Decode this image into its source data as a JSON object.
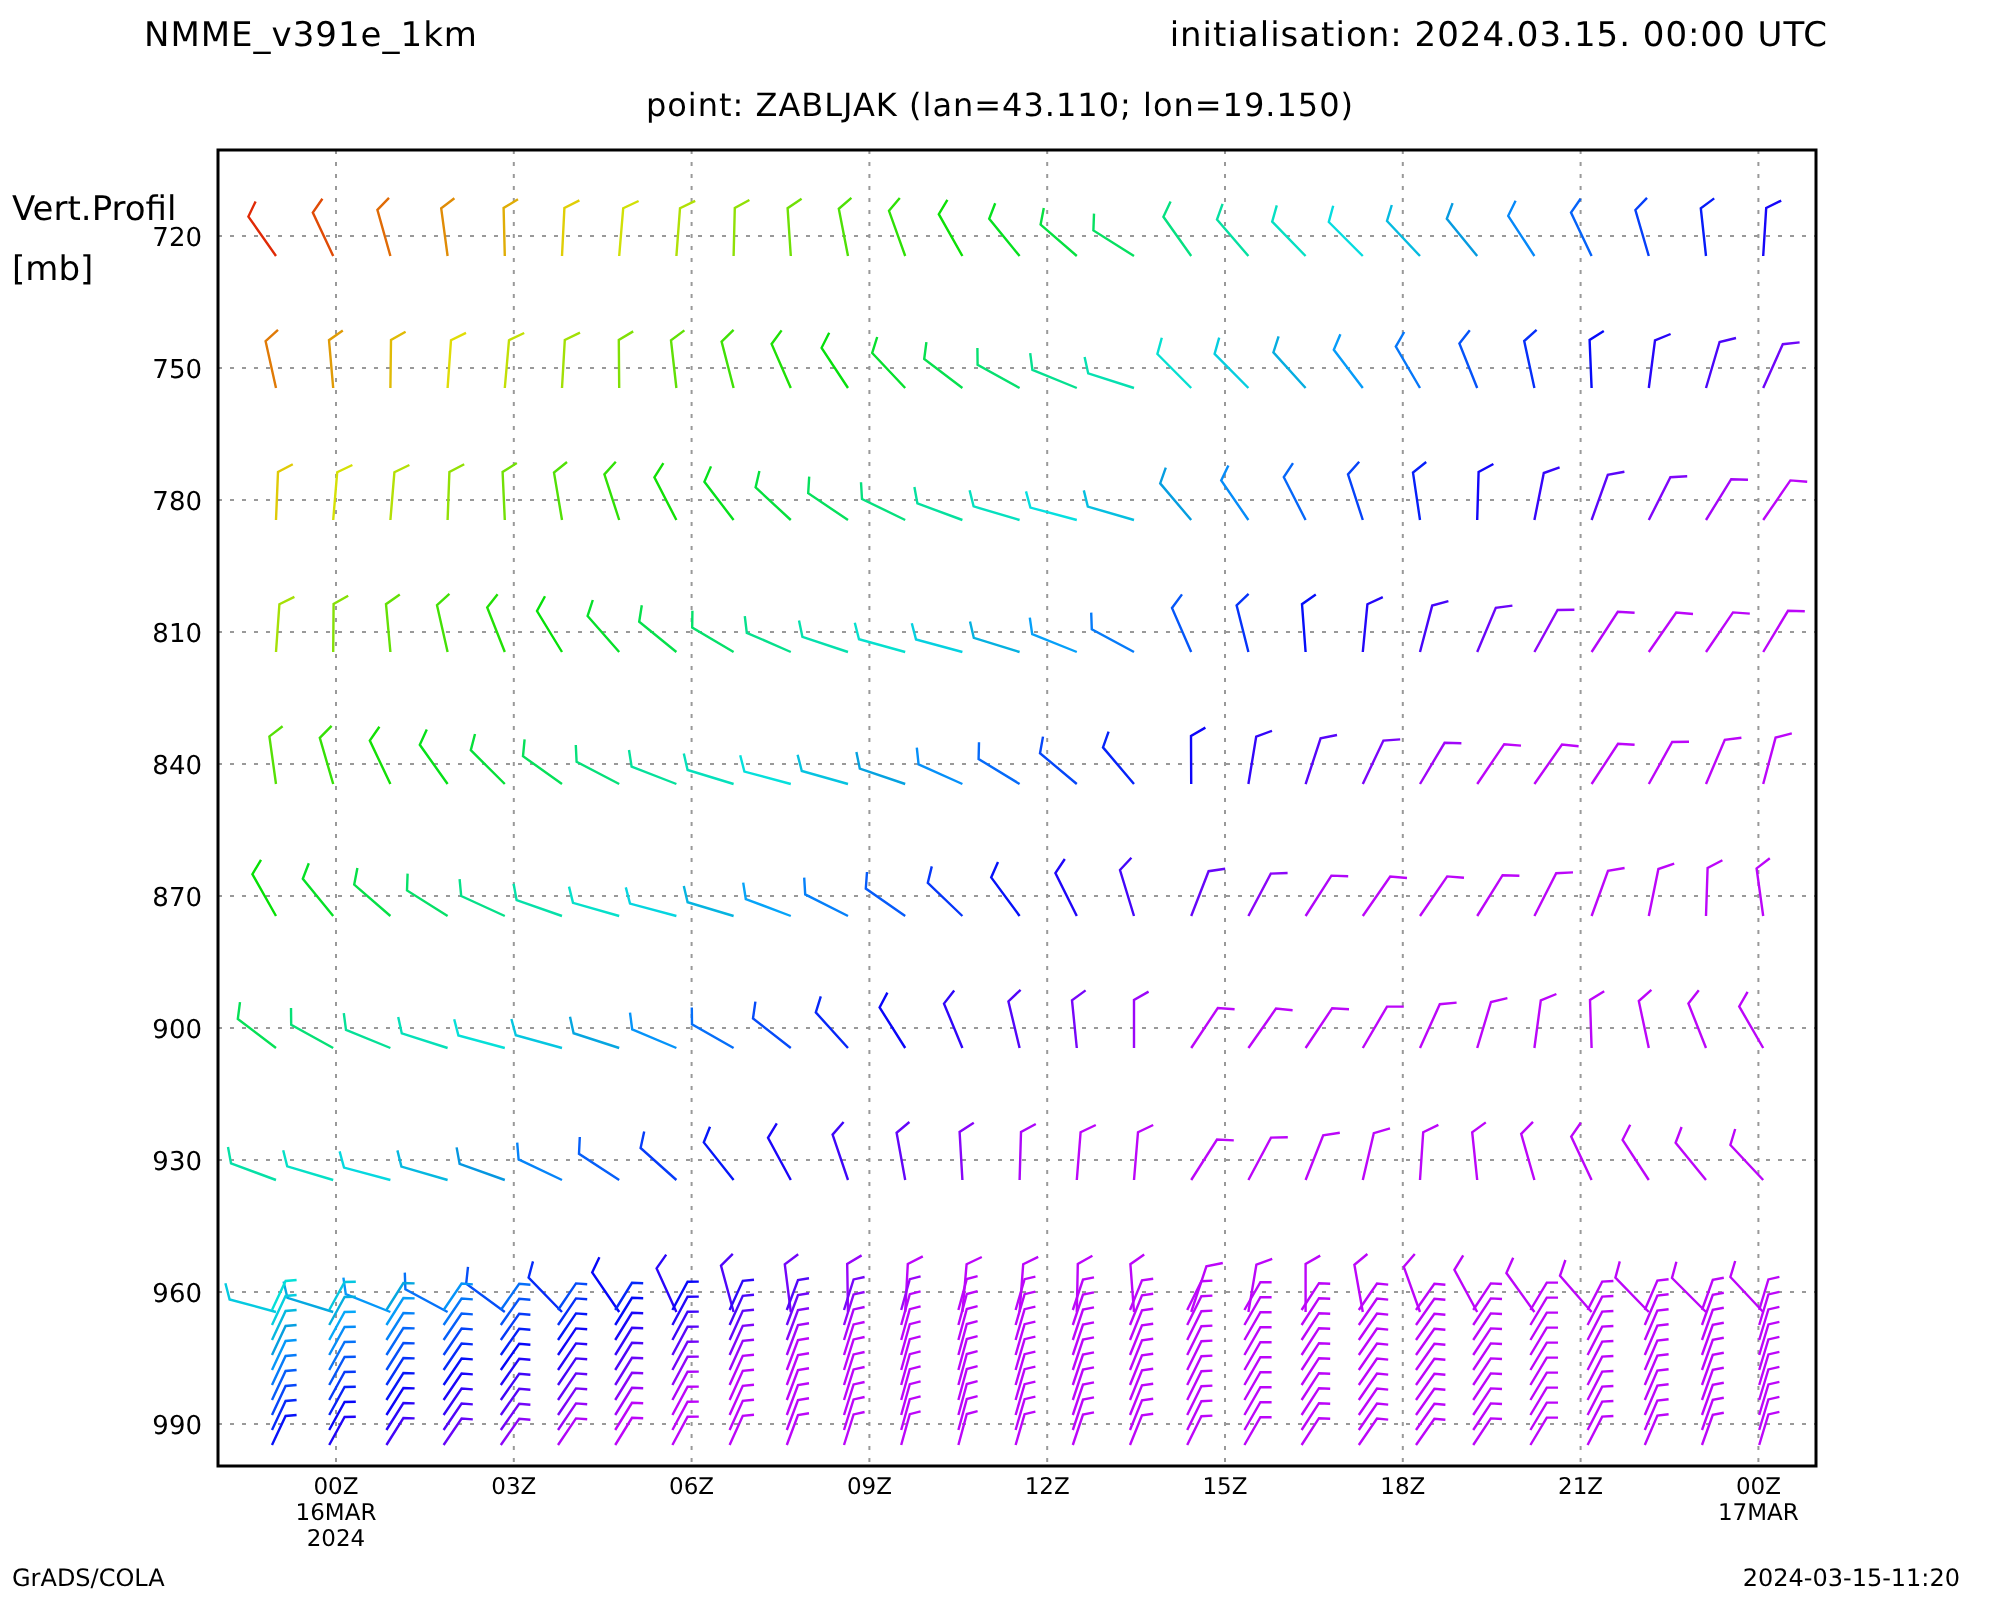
{
  "header": {
    "model": "NMME_v391e_1km",
    "initialisation": "initialisation: 2024.03.15. 00:00 UTC",
    "point": "point: ZABLJAK (lan=43.110; lon=19.150)"
  },
  "chart": {
    "ylabel": "Vert.Profil",
    "yunit": "[mb]",
    "yticks": [
      "720",
      "750",
      "780",
      "810",
      "840",
      "870",
      "900",
      "930",
      "960",
      "990"
    ],
    "xticks": [
      {
        "lines": [
          "00Z",
          "16MAR",
          "2024"
        ]
      },
      {
        "lines": [
          "03Z"
        ]
      },
      {
        "lines": [
          "06Z"
        ]
      },
      {
        "lines": [
          "09Z"
        ]
      },
      {
        "lines": [
          "12Z"
        ]
      },
      {
        "lines": [
          "15Z"
        ]
      },
      {
        "lines": [
          "18Z"
        ]
      },
      {
        "lines": [
          "21Z"
        ]
      },
      {
        "lines": [
          "00Z",
          "17MAR"
        ]
      }
    ]
  },
  "footer": {
    "left": "GrADS/COLA",
    "right": "2024-03-15-11:20"
  }
}
